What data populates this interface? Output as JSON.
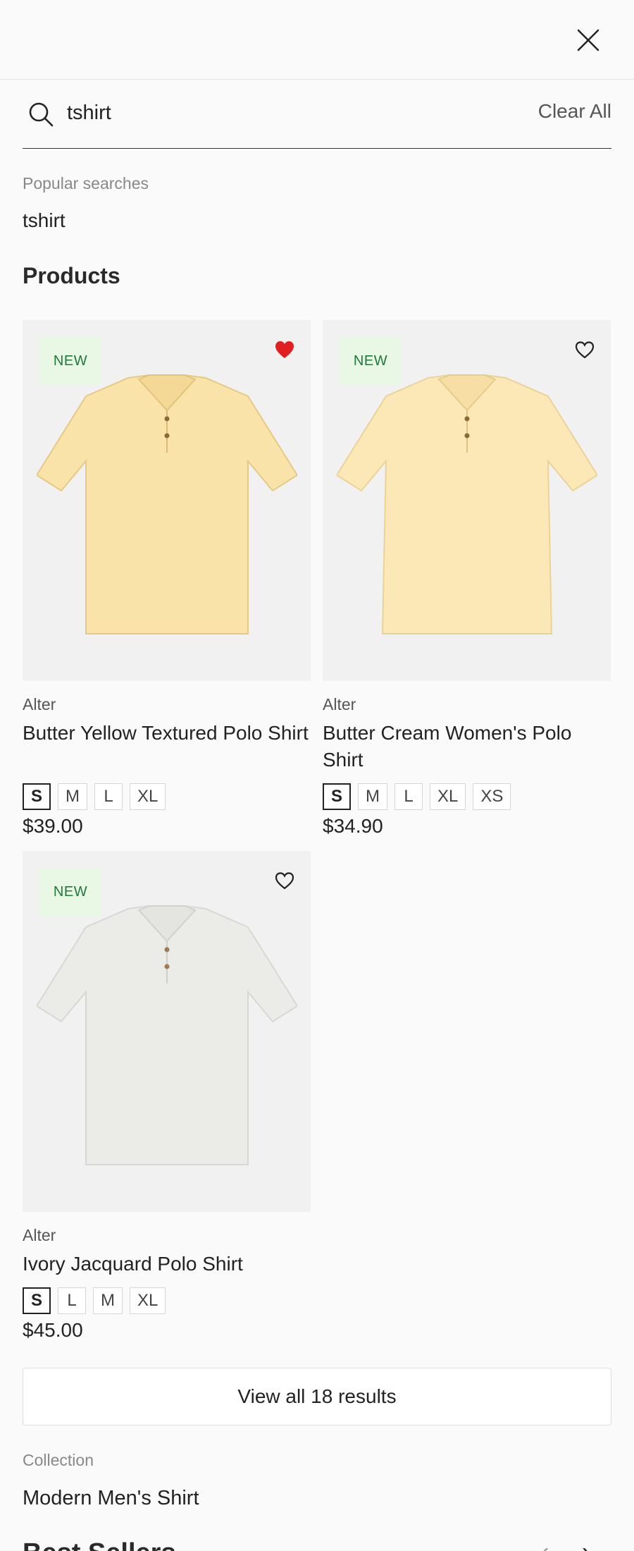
{
  "search": {
    "query": "tshirt",
    "clear_label": "Clear All"
  },
  "popular": {
    "label": "Popular searches",
    "terms": [
      "tshirt"
    ]
  },
  "products": {
    "heading": "Products",
    "items": [
      {
        "badge": "NEW",
        "favorited": true,
        "brand": "Alter",
        "name": "Butter Yellow Textured Polo Shirt",
        "sizes": [
          "S",
          "M",
          "L",
          "XL"
        ],
        "selected_size": "S",
        "price": "$39.00",
        "shirt_color": "#f9e3a8",
        "heart_icon": "heart-filled-icon"
      },
      {
        "badge": "NEW",
        "favorited": false,
        "brand": "Alter",
        "name": "Butter Cream Women's Polo Shirt",
        "sizes": [
          "S",
          "M",
          "L",
          "XL",
          "XS"
        ],
        "selected_size": "S",
        "price": "$34.90",
        "shirt_color": "#fbe8b6",
        "heart_icon": "heart-outline-icon"
      },
      {
        "badge": "NEW",
        "favorited": false,
        "brand": "Alter",
        "name": "Ivory Jacquard Polo Shirt",
        "sizes": [
          "S",
          "L",
          "M",
          "XL"
        ],
        "selected_size": "S",
        "price": "$45.00",
        "shirt_color": "#ebebe8",
        "heart_icon": "heart-outline-icon"
      }
    ]
  },
  "view_all_label": "View all 18 results",
  "collection": {
    "label": "Collection",
    "items": [
      "Modern Men's Shirt"
    ]
  },
  "bestsellers": {
    "heading": "Best Sellers"
  },
  "icons": {
    "close": "close-icon",
    "search": "search-icon",
    "prev": "chevron-left-icon",
    "next": "chevron-right-icon"
  },
  "colors": {
    "favorite": "#e02020",
    "badge_bg": "#e8f8e4",
    "badge_text": "#1c7a3a"
  }
}
